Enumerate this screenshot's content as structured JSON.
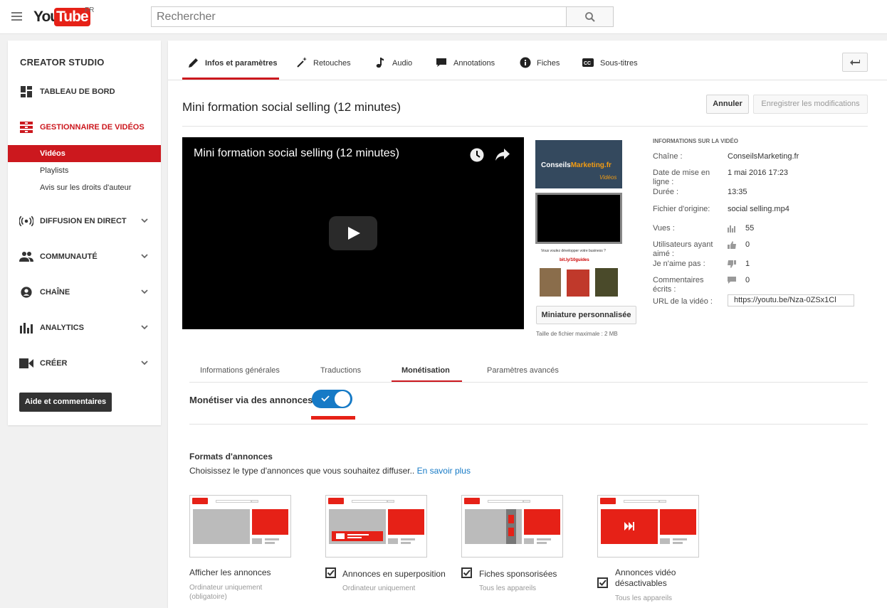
{
  "topbar": {
    "logo_you": "You",
    "logo_tube": "Tube",
    "logo_region": "FR",
    "search_placeholder": "Rechercher"
  },
  "sidebar": {
    "title": "CREATOR STUDIO",
    "dashboard": "TABLEAU DE BORD",
    "video_manager": "GESTIONNAIRE DE VIDÉOS",
    "sub": [
      "Vidéos",
      "Playlists",
      "Avis sur les droits d'auteur"
    ],
    "live": "DIFFUSION EN DIRECT",
    "community": "COMMUNAUTÉ",
    "channel": "CHAÎNE",
    "analytics": "ANALYTICS",
    "create": "CRÉER",
    "help_button": "Aide et commentaires"
  },
  "tabs": [
    "Infos et paramètres",
    "Retouches",
    "Audio",
    "Annotations",
    "Fiches",
    "Sous-titres"
  ],
  "video": {
    "title": "Mini formation social selling (12 minutes)",
    "cancel": "Annuler",
    "save": "Enregistrer les modifications",
    "thumb_brand": "Conseils",
    "thumb_brand2": "Marketing.fr",
    "thumb_sub": "Vidéos",
    "thumb3_line1": "Vous voulez développer votre business ?",
    "thumb3_line2": "bit.ly/10guides",
    "custom_thumb": "Miniature personnalisée",
    "max_size": "Taille de fichier maximale : 2 MB"
  },
  "info": {
    "heading": "INFORMATIONS SUR LA VIDÉO",
    "channel_k": "Chaîne :",
    "channel_v": "ConseilsMarketing.fr",
    "date_k": "Date de mise en ligne :",
    "date_v": "1 mai 2016 17:23",
    "duration_k": "Durée :",
    "duration_v": "13:35",
    "file_k": "Fichier d'origine:",
    "file_v": "social selling.mp4",
    "views_k": "Vues :",
    "views_v": "55",
    "likes_k": "Utilisateurs ayant aimé :",
    "likes_v": "0",
    "dislikes_k": "Je n'aime pas :",
    "dislikes_v": "1",
    "comments_k": "Commentaires écrits :",
    "comments_v": "0",
    "url_k": "URL de la vidéo :",
    "url_v": "https://youtu.be/Nza-0ZSx1Cl"
  },
  "subtabs": [
    "Informations générales",
    "Traductions",
    "Monétisation",
    "Paramètres avancés"
  ],
  "monetize": {
    "label": "Monétiser via des annonces",
    "enabled": true
  },
  "formats": {
    "heading": "Formats d'annonces",
    "desc": "Choisissez le type d'annonces que vous souhaitez diffuser..",
    "learn_more": "En savoir plus",
    "items": [
      {
        "name": "Afficher les annonces",
        "sub": "Ordinateur uniquement (obligatoire)",
        "checked": null
      },
      {
        "name": "Annonces en superposition",
        "sub": "Ordinateur uniquement",
        "checked": true
      },
      {
        "name": "Fiches sponsorisées",
        "sub": "Tous les appareils",
        "checked": true
      },
      {
        "name": "Annonces vidéo désactivables",
        "sub": "Tous les appareils",
        "checked": true
      }
    ]
  },
  "colors": {
    "brand_red": "#e62117",
    "accent_blue": "#167ac6",
    "active_red": "#cc181e"
  }
}
